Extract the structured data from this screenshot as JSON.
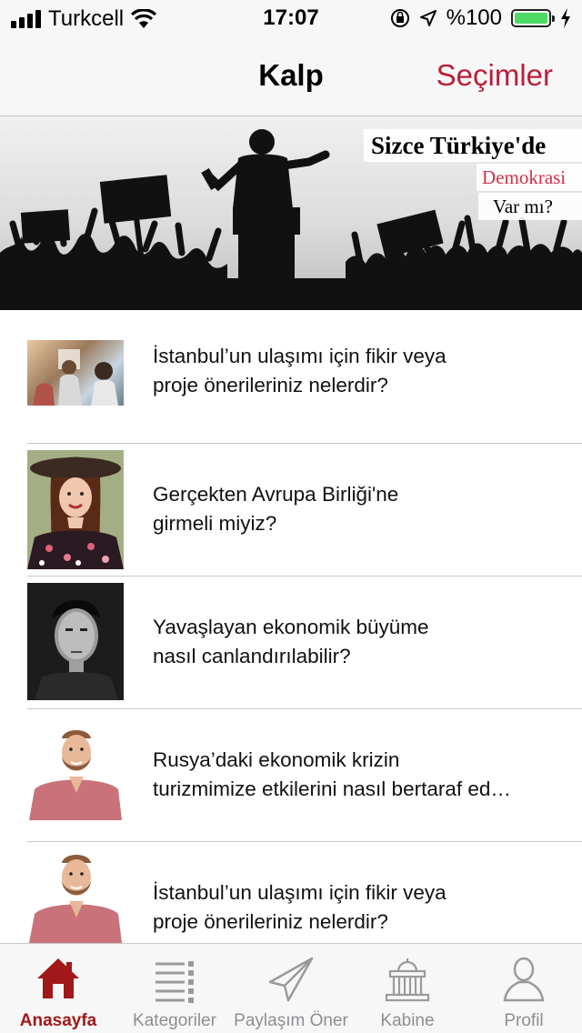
{
  "status_bar": {
    "carrier": "Turkcell",
    "time": "17:07",
    "battery": "%100",
    "battery_level": 1.0
  },
  "nav": {
    "title": "Kalp",
    "action": "Seçimler",
    "accent_color": "#b8203a"
  },
  "banner": {
    "headline": "Sizce Türkiye'de",
    "highlight": "Demokrasi",
    "question": "Var mı?"
  },
  "feed": {
    "items": [
      {
        "thumb_icon": "conference-photo",
        "line1": "İstanbul’un ulaşımı için fikir veya",
        "line2": "proje önerileriniz nelerdir?"
      },
      {
        "thumb_icon": "woman-in-hat-photo",
        "line1": "Gerçekten Avrupa Birliği'ne",
        "line2": "girmeli miyiz?"
      },
      {
        "thumb_icon": "man-portrait-photo",
        "line1": "Yavaşlayan ekonomik büyüme",
        "line2": "nasıl canlandırılabilir?"
      },
      {
        "thumb_icon": "bearded-man-photo",
        "line1": "Rusya’daki ekonomik krizin",
        "line2": "turizmimize etkilerini nasıl bertaraf ed…"
      },
      {
        "thumb_icon": "bearded-man-photo",
        "line1": "İstanbul’un ulaşımı için fikir veya",
        "line2": "proje önerileriniz nelerdir?"
      }
    ]
  },
  "tabs": [
    {
      "label": "Anasayfa",
      "icon": "home-icon",
      "active": true
    },
    {
      "label": "Kategoriler",
      "icon": "list-icon",
      "active": false
    },
    {
      "label": "Paylaşım Öner",
      "icon": "paper-plane-icon",
      "active": false
    },
    {
      "label": "Kabine",
      "icon": "parliament-icon",
      "active": false
    },
    {
      "label": "Profil",
      "icon": "person-icon",
      "active": false
    }
  ],
  "colors": {
    "active_tab": "#a01818",
    "inactive_tab": "#8e8e93"
  }
}
